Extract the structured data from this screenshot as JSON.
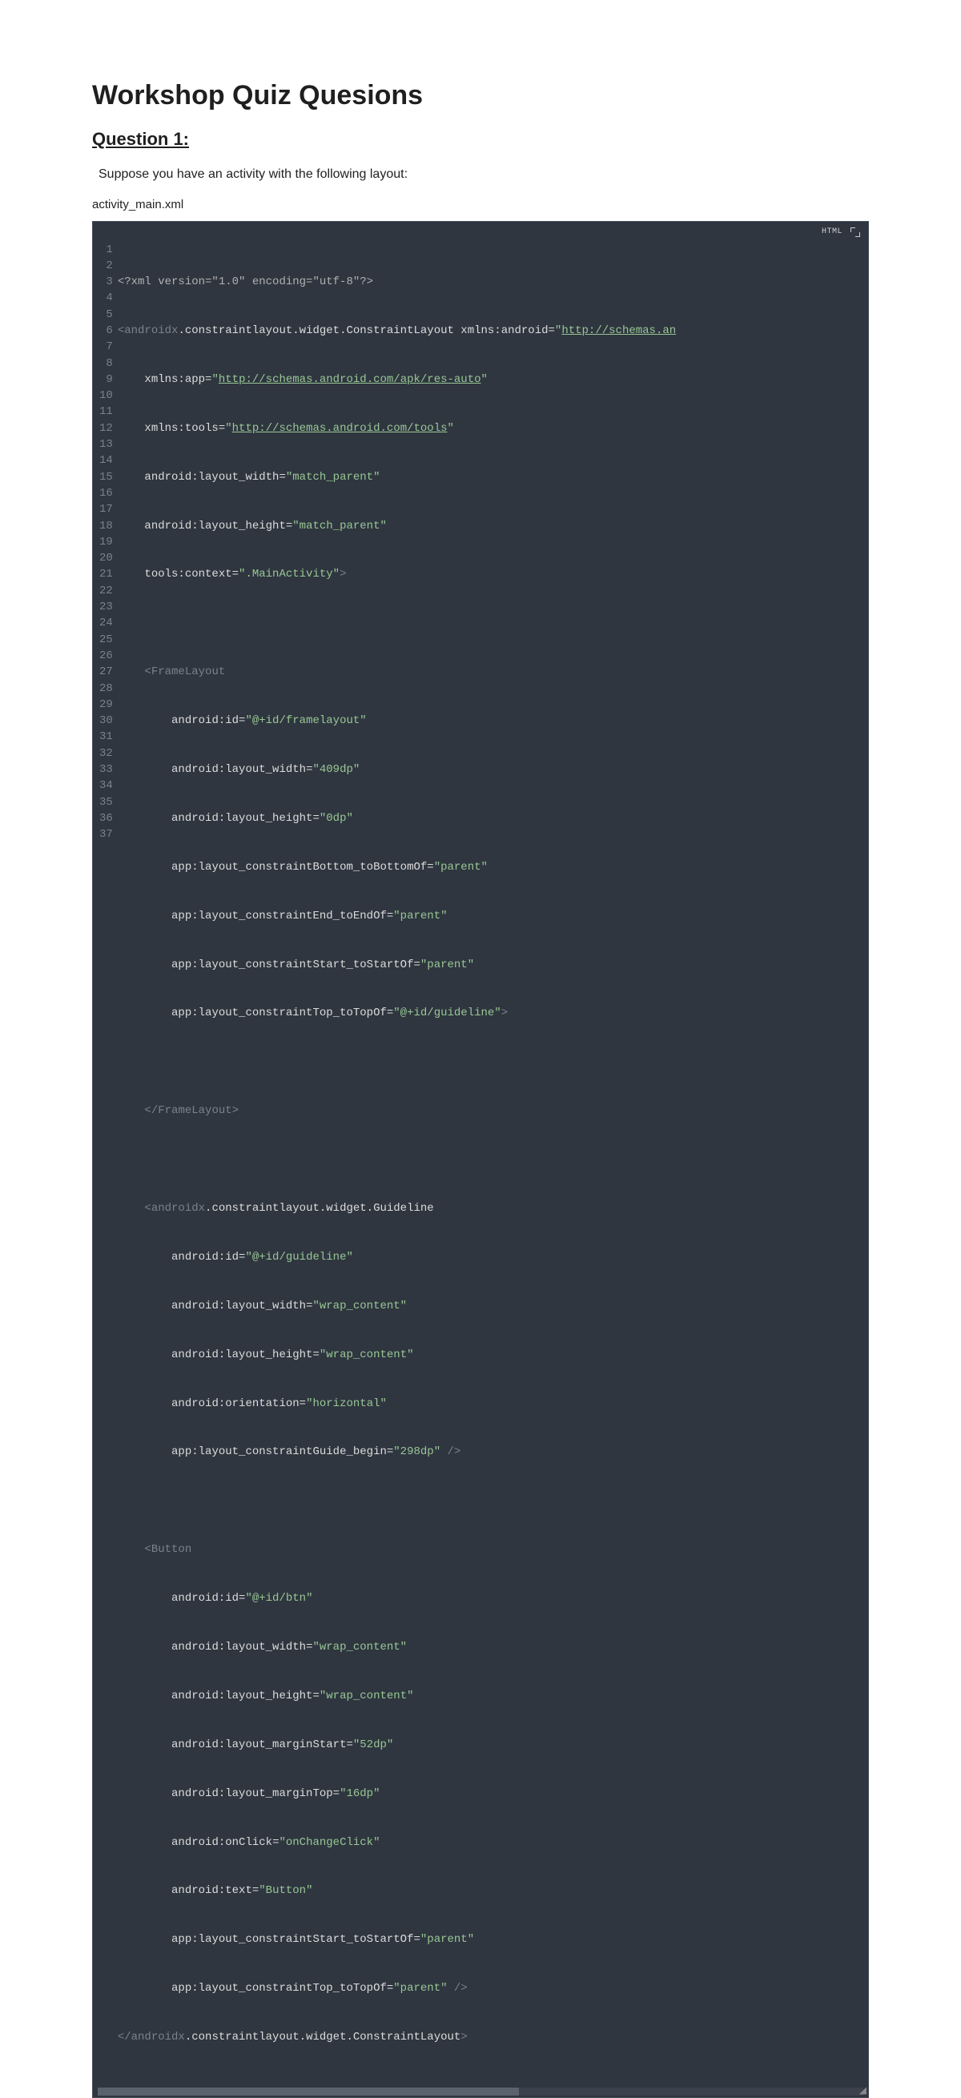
{
  "title": "Workshop Quiz Quesions",
  "question_heading": "Question 1:",
  "prompt": "Suppose you have an activity with the following layout:",
  "filename": "activity_main.xml",
  "code_lang": "HTML",
  "line_numbers": [
    "1",
    "2",
    "3",
    "4",
    "5",
    "6",
    "7",
    "8",
    "9",
    "10",
    "11",
    "12",
    "13",
    "14",
    "15",
    "16",
    "17",
    "18",
    "19",
    "20",
    "21",
    "22",
    "23",
    "24",
    "25",
    "26",
    "27",
    "28",
    "29",
    "30",
    "31",
    "32",
    "33",
    "34",
    "35",
    "36",
    "37"
  ],
  "code": {
    "l1": {
      "pi": "<?xml version=\"1.0\" encoding=\"utf-8\"?>"
    },
    "l2": {
      "lt": "<",
      "tag": "androidx",
      "elem": ".constraintlayout.widget.ConstraintLayout ",
      "attr": "xmlns:android",
      "eq": "=",
      "q1": "\"",
      "link": "http://schemas.an"
    },
    "l3": {
      "indent": "    ",
      "attr": "xmlns:app",
      "eq": "=",
      "q1": "\"",
      "link": "http://schemas.android.com/apk/res-auto",
      "q2": "\""
    },
    "l4": {
      "indent": "    ",
      "attr": "xmlns:tools",
      "eq": "=",
      "q1": "\"",
      "link": "http://schemas.android.com/tools",
      "q2": "\""
    },
    "l5": {
      "indent": "    ",
      "attr": "android:layout_width",
      "eq": "=",
      "str": "\"match_parent\""
    },
    "l6": {
      "indent": "    ",
      "attr": "android:layout_height",
      "eq": "=",
      "str": "\"match_parent\""
    },
    "l7": {
      "indent": "    ",
      "attr": "tools:context",
      "eq": "=",
      "str": "\".MainActivity\"",
      "gt": ">"
    },
    "l8": {
      "blank": " "
    },
    "l9": {
      "indent": "    ",
      "lt": "<",
      "tag": "FrameLayout"
    },
    "l10": {
      "indent": "        ",
      "attr": "android:id",
      "eq": "=",
      "str": "\"@+id/framelayout\""
    },
    "l11": {
      "indent": "        ",
      "attr": "android:layout_width",
      "eq": "=",
      "str": "\"409dp\""
    },
    "l12": {
      "indent": "        ",
      "attr": "android:layout_height",
      "eq": "=",
      "str": "\"0dp\""
    },
    "l13": {
      "indent": "        ",
      "attr": "app:layout_constraintBottom_toBottomOf",
      "eq": "=",
      "str": "\"parent\""
    },
    "l14": {
      "indent": "        ",
      "attr": "app:layout_constraintEnd_toEndOf",
      "eq": "=",
      "str": "\"parent\""
    },
    "l15": {
      "indent": "        ",
      "attr": "app:layout_constraintStart_toStartOf",
      "eq": "=",
      "str": "\"parent\""
    },
    "l16": {
      "indent": "        ",
      "attr": "app:layout_constraintTop_toTopOf",
      "eq": "=",
      "str": "\"@+id/guideline\"",
      "gt": ">"
    },
    "l17": {
      "blank": " "
    },
    "l18": {
      "indent": "    ",
      "lt": "</",
      "tag": "FrameLayout",
      "gt": ">"
    },
    "l19": {
      "blank": " "
    },
    "l20": {
      "indent": "    ",
      "lt": "<",
      "tag": "androidx",
      "elem": ".constraintlayout.widget.Guideline"
    },
    "l21": {
      "indent": "        ",
      "attr": "android:id",
      "eq": "=",
      "str": "\"@+id/guideline\""
    },
    "l22": {
      "indent": "        ",
      "attr": "android:layout_width",
      "eq": "=",
      "str": "\"wrap_content\""
    },
    "l23": {
      "indent": "        ",
      "attr": "android:layout_height",
      "eq": "=",
      "str": "\"wrap_content\""
    },
    "l24": {
      "indent": "        ",
      "attr": "android:orientation",
      "eq": "=",
      "str": "\"horizontal\""
    },
    "l25": {
      "indent": "        ",
      "attr": "app:layout_constraintGuide_begin",
      "eq": "=",
      "str": "\"298dp\"",
      "close": " />"
    },
    "l26": {
      "blank": " "
    },
    "l27": {
      "indent": "    ",
      "lt": "<",
      "tag": "Button"
    },
    "l28": {
      "indent": "        ",
      "attr": "android:id",
      "eq": "=",
      "str": "\"@+id/btn\""
    },
    "l29": {
      "indent": "        ",
      "attr": "android:layout_width",
      "eq": "=",
      "str": "\"wrap_content\""
    },
    "l30": {
      "indent": "        ",
      "attr": "android:layout_height",
      "eq": "=",
      "str": "\"wrap_content\""
    },
    "l31": {
      "indent": "        ",
      "attr": "android:layout_marginStart",
      "eq": "=",
      "str": "\"52dp\""
    },
    "l32": {
      "indent": "        ",
      "attr": "android:layout_marginTop",
      "eq": "=",
      "str": "\"16dp\""
    },
    "l33": {
      "indent": "        ",
      "attr": "android:onClick",
      "eq": "=",
      "str": "\"onChangeClick\""
    },
    "l34": {
      "indent": "        ",
      "attr": "android:text",
      "eq": "=",
      "str": "\"Button\""
    },
    "l35": {
      "indent": "        ",
      "attr": "app:layout_constraintStart_toStartOf",
      "eq": "=",
      "str": "\"parent\""
    },
    "l36": {
      "indent": "        ",
      "attr": "app:layout_constraintTop_toTopOf",
      "eq": "=",
      "str": "\"parent\"",
      "close": " />"
    },
    "l37": {
      "lt": "</",
      "tag": "androidx",
      "elem": ".constraintlayout.widget.ConstraintLayout",
      "gt": ">"
    }
  }
}
